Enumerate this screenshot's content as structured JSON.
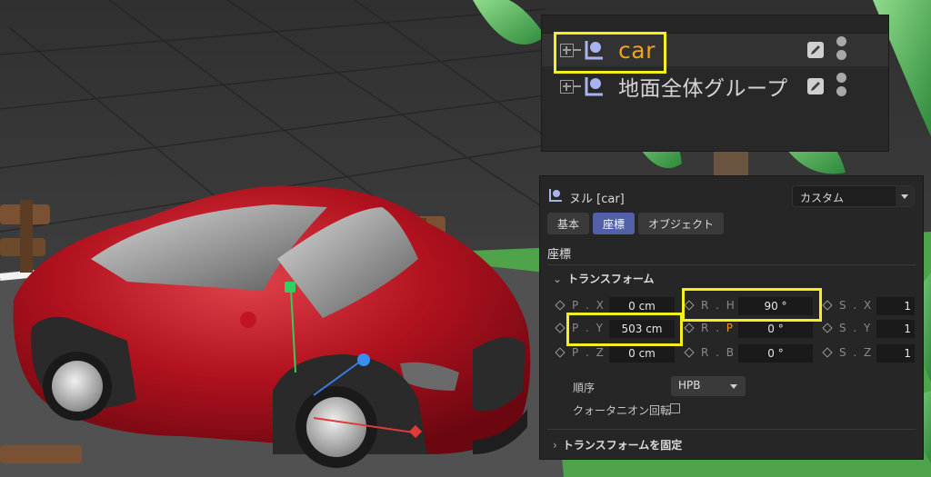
{
  "object_manager": {
    "items": [
      {
        "name": "car",
        "selected": true
      },
      {
        "name": "地面全体グループ",
        "selected": false
      }
    ]
  },
  "attributes": {
    "title": "ヌル [car]",
    "mode": "カスタム",
    "tabs": [
      {
        "label": "基本",
        "active": false
      },
      {
        "label": "座標",
        "active": true
      },
      {
        "label": "オブジェクト",
        "active": false
      }
    ],
    "section": "座標",
    "transform_group": "トランスフォーム",
    "position": {
      "x": {
        "label": "P . X",
        "value": "0 cm"
      },
      "y": {
        "label": "P . Y",
        "value": "503 cm"
      },
      "z": {
        "label": "P . Z",
        "value": "0 cm"
      }
    },
    "rotation": {
      "h": {
        "label": "R . H",
        "value": "90 °"
      },
      "p": {
        "label_prefix": "R . ",
        "label_hot": "P",
        "value": "0 °"
      },
      "b": {
        "label": "R . B",
        "value": "0 °"
      }
    },
    "scale": {
      "x": {
        "label": "S . X",
        "value": "1"
      },
      "y": {
        "label": "S . Y",
        "value": "1"
      },
      "z": {
        "label": "S . Z",
        "value": "1"
      }
    },
    "order": {
      "label": "順序",
      "value": "HPB"
    },
    "quaternion": {
      "label": "クォータニオン回転",
      "checked": false
    },
    "freeze_group": "トランスフォームを固定"
  },
  "colors": {
    "highlight": "#f5ef1f",
    "active_name": "#f2a21c",
    "active_tab": "#5260a8",
    "car_body": "#b3121f"
  }
}
